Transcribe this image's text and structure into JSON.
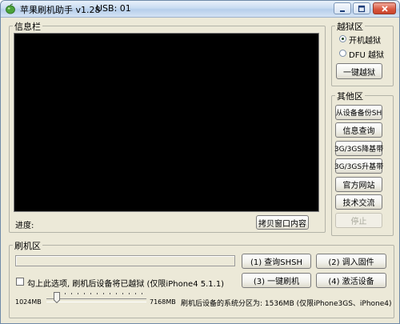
{
  "window": {
    "title": "苹果刷机助手 v1.28",
    "usb": "USB: 01"
  },
  "info_group": {
    "label": "信息栏",
    "progress_label": "进度:",
    "copy_button": "拷贝窗口内容"
  },
  "jailbreak_group": {
    "label": "越狱区",
    "options": [
      "开机越狱",
      "DFU 越狱"
    ],
    "selected": "开机越狱",
    "one_click_button": "一键越狱"
  },
  "other_group": {
    "label": "其他区",
    "buttons": [
      "从设备备份SH",
      "信息查询",
      "3G/3GS降基带",
      "3G/3GS升基带",
      "官方网站",
      "技术交流",
      "停止"
    ],
    "disabled": "停止"
  },
  "flash_group": {
    "label": "刷机区",
    "progress_percent": 0,
    "checkbox_label": "勾上此选项, 刷机后设备将已越狱 (仅限iPhone4 5.1.1)",
    "checkbox_checked": false,
    "buttons": {
      "query_shsh": "(1) 查询SHSH",
      "import_firmware": "(2) 调入固件",
      "one_click_flash": "(3) 一键刷机",
      "activate": "(4) 激活设备"
    },
    "slider_min": "1024MB",
    "slider_max": "7168MB",
    "partition_text": "刷机后设备的系统分区为: 1536MB (仅限iPhone3GS、iPhone4)",
    "partition_mb": 1536
  },
  "colors": {
    "window_bg": "#ece9d8",
    "console_bg": "#000000",
    "close_button": "#d8563e"
  },
  "icons": [
    "app-leaf-icon",
    "minimize-icon",
    "maximize-icon",
    "close-icon"
  ]
}
